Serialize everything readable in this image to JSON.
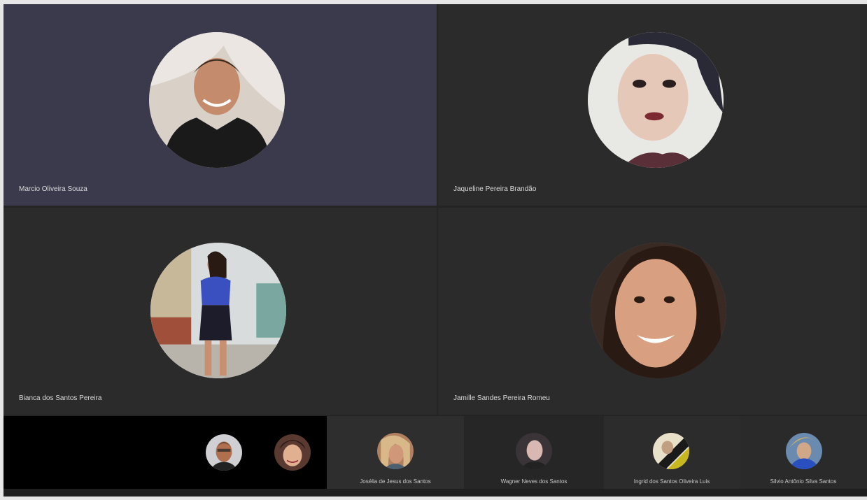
{
  "participants": [
    {
      "name": "Marcio Oliveira Souza"
    },
    {
      "name": "Jaqueline Pereira Brandão"
    },
    {
      "name": "Bianca dos Santos Pereira"
    },
    {
      "name": "Jamille Sandes Pereira Romeu"
    }
  ],
  "thumbnails": [
    {
      "name": ""
    },
    {
      "name": ""
    },
    {
      "name": "Josélia de Jesus dos Santos"
    },
    {
      "name": "Wagner Neves dos Santos"
    },
    {
      "name": "Ingrid dos Santos Oliveira Luis"
    },
    {
      "name": "Silvio Antônio Silva Santos"
    }
  ],
  "colors": {
    "active_tile": "#3b3a4c",
    "tile": "#2b2b2b",
    "strip_black": "#000000"
  }
}
